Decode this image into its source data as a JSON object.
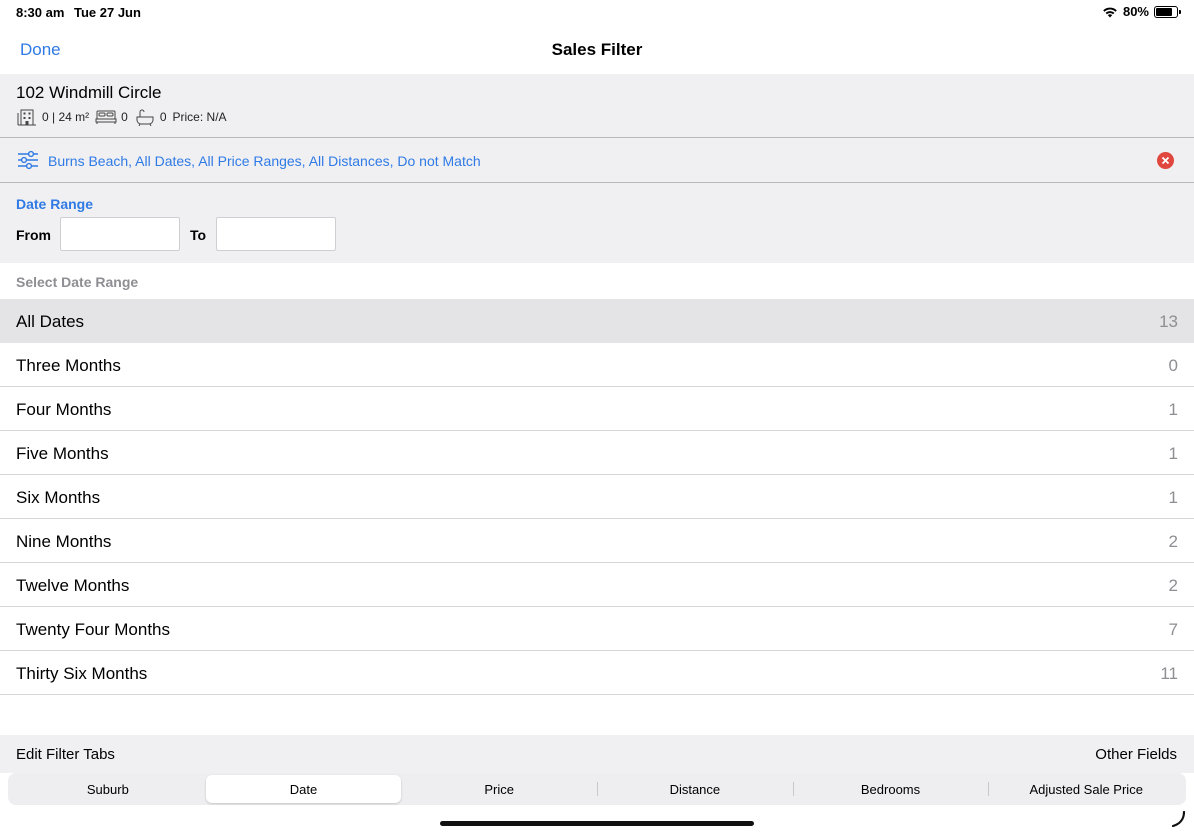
{
  "status_bar": {
    "time": "8:30 am",
    "date": "Tue 27 Jun",
    "battery_percent": "80%",
    "battery_level": 0.8
  },
  "nav": {
    "done_label": "Done",
    "title": "Sales Filter"
  },
  "property": {
    "address": "102 Windmill Circle",
    "building": "0 | 24 m²",
    "beds": "0",
    "baths": "0",
    "price": "Price: N/A"
  },
  "filter_summary": {
    "text": "Burns Beach, All Dates, All Price Ranges, All Distances, Do not Match",
    "accent": "#2f7ae5",
    "clear_color": "#e0473f"
  },
  "date_range": {
    "title": "Date Range",
    "from_label": "From",
    "from_value": "",
    "to_label": "To",
    "to_value": ""
  },
  "select_header": "Select Date Range",
  "ranges": [
    {
      "label": "All Dates",
      "count": "13",
      "selected": true
    },
    {
      "label": "Three Months",
      "count": "0"
    },
    {
      "label": "Four Months",
      "count": "1"
    },
    {
      "label": "Five Months",
      "count": "1"
    },
    {
      "label": "Six Months",
      "count": "1"
    },
    {
      "label": "Nine Months",
      "count": "2"
    },
    {
      "label": "Twelve Months",
      "count": "2"
    },
    {
      "label": "Twenty Four Months",
      "count": "7"
    },
    {
      "label": "Thirty Six Months",
      "count": "11"
    }
  ],
  "footer": {
    "edit_tabs": "Edit Filter Tabs",
    "other_fields": "Other Fields"
  },
  "tabs": [
    {
      "label": "Suburb"
    },
    {
      "label": "Date",
      "active": true
    },
    {
      "label": "Price"
    },
    {
      "label": "Distance"
    },
    {
      "label": "Bedrooms"
    },
    {
      "label": "Adjusted Sale Price"
    }
  ]
}
